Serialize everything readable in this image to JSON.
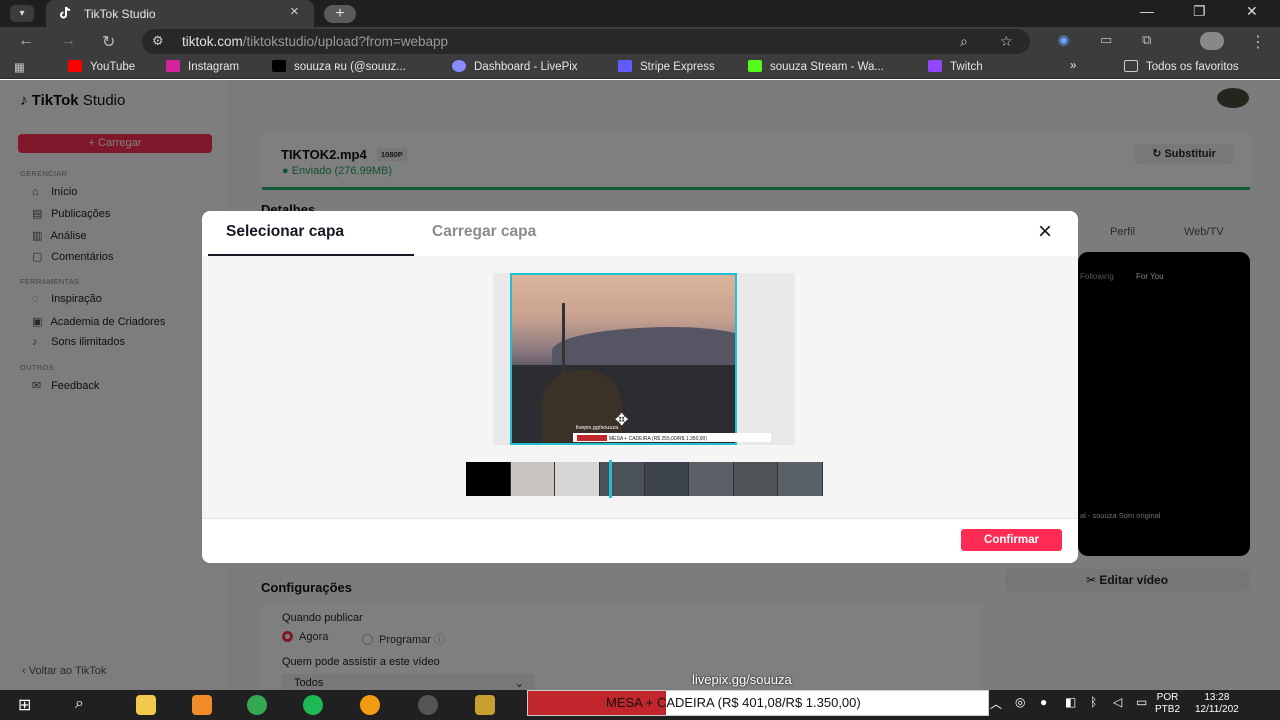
{
  "browser": {
    "tab_title": "TikTok Studio",
    "new_tab": "+",
    "url_host": "tiktok.com",
    "url_path": "/tiktokstudio/upload?from=webapp",
    "bookmarks": [
      {
        "label": "YouTube",
        "color": "#ff0000"
      },
      {
        "label": "Instagram",
        "color": "#d6249f"
      },
      {
        "label": "souuza ʀu (@souuz...",
        "color": "#000000"
      },
      {
        "label": "Dashboard - LivePix",
        "color": "#8a8aff"
      },
      {
        "label": "Stripe Express",
        "color": "#635bff"
      },
      {
        "label": "souuza Stream - Wa...",
        "color": "#53fc18"
      },
      {
        "label": "Twitch",
        "color": "#9146ff"
      }
    ],
    "bookmarks_overflow": "»",
    "all_bookmarks": "Todos os favoritos"
  },
  "sidebar": {
    "logo": "TikTok",
    "logo_suffix": "Studio",
    "upload_label": "+ Carregar",
    "sections": {
      "manage": "GERENCIAR",
      "tools": "FERRAMENTAS",
      "others": "OUTROS"
    },
    "items": [
      {
        "label": "Início",
        "icon": "home-icon"
      },
      {
        "label": "Publicações",
        "icon": "posts-icon"
      },
      {
        "label": "Análise",
        "icon": "analytics-icon"
      },
      {
        "label": "Comentários",
        "icon": "comments-icon"
      },
      {
        "label": "Inspiração",
        "icon": "bulb-icon"
      },
      {
        "label": "Academia de Criadores",
        "icon": "academy-icon"
      },
      {
        "label": "Sons ilimitados",
        "icon": "music-icon"
      },
      {
        "label": "Feedback",
        "icon": "feedback-icon"
      }
    ],
    "back_link": "‹  Voltar ao TikTok"
  },
  "main": {
    "file_name": "TIKTOK2.mp4",
    "file_badge": "1080P",
    "upload_status": "Enviado  (276.99MB)",
    "replace_label": "Substituir",
    "details_title": "Detalhes",
    "preview_tabs": [
      "Perfil",
      "Web/TV"
    ],
    "phone_tabs": [
      "Following",
      "For You"
    ],
    "phone_caption": "al - souuza     Som original",
    "edit_video_label": "Editar vídeo",
    "settings_title": "Configurações",
    "when_label": "Quando publicar",
    "when_options": [
      "Agora",
      "Programar"
    ],
    "who_label": "Quem pode assistir a este vídeo",
    "who_value": "Todos"
  },
  "modal": {
    "tab_select": "Selecionar capa",
    "tab_upload": "Carregar capa",
    "close_icon": "×",
    "cover_caption": "livepix.gg/souuza",
    "cover_bar": "MESA + CADEIRA (R$ 255,00/R$ 1.350,00)",
    "move_icon": "✥",
    "confirm_label": "Confirmar"
  },
  "stream_overlay": {
    "url": "livepix.gg/souuza",
    "bar_text": "MESA + CADEIRA (R$ 401,08/R$ 1.350,00)"
  },
  "taskbar": {
    "lang_1": "POR",
    "lang_2": "PTB2",
    "time": "13:28",
    "date": "12/11/202"
  }
}
